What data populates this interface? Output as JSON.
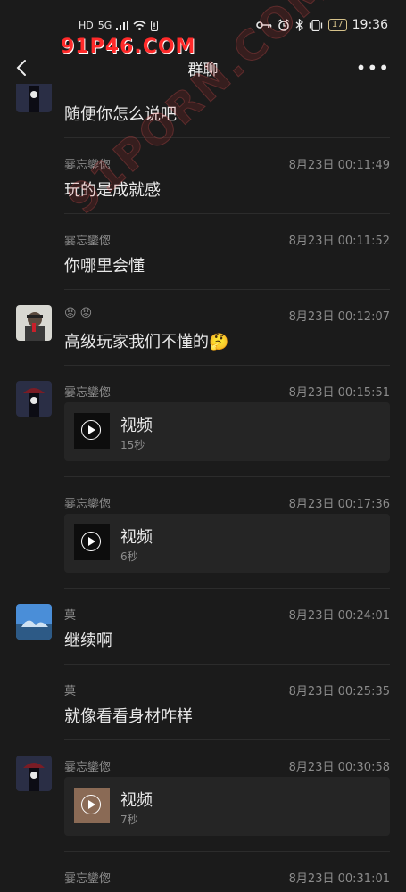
{
  "status_bar": {
    "left_icons": [
      "HD",
      "5G",
      "signal-icon",
      "wifi-icon",
      "alert-icon"
    ],
    "right_icons": [
      "key-icon",
      "alarm-icon",
      "bluetooth-icon",
      "vibrate-icon"
    ],
    "battery": "17",
    "time": "19:36"
  },
  "watermark": {
    "top": "91P46.COM",
    "diagonal": "91PORN.COM"
  },
  "nav": {
    "title": "群聊",
    "more": "•••"
  },
  "messages": [
    {
      "sender": "",
      "time": "",
      "text": "随便你怎么说吧"
    },
    {
      "sender": "霎忘鑾偬",
      "time": "8月23日 00:11:49",
      "text": "玩的是成就感"
    },
    {
      "sender": "霎忘鑾偬",
      "time": "8月23日 00:11:52",
      "text": "你哪里会懂"
    },
    {
      "sender": "😡 😡",
      "time": "8月23日 00:12:07",
      "text": "高级玩家我们不懂的🤔"
    },
    {
      "sender": "霎忘鑾偬",
      "time": "8月23日 00:15:51",
      "video_label": "视频",
      "duration": "15秒"
    },
    {
      "sender": "霎忘鑾偬",
      "time": "8月23日 00:17:36",
      "video_label": "视频",
      "duration": "6秒"
    },
    {
      "sender": "菓",
      "time": "8月23日 00:24:01",
      "text": "继续啊"
    },
    {
      "sender": "菓",
      "time": "8月23日 00:25:35",
      "text": "就像看看身材咋样"
    },
    {
      "sender": "霎忘鑾偬",
      "time": "8月23日 00:30:58",
      "video_label": "视频",
      "duration": "7秒"
    },
    {
      "sender": "霎忘鑾偬",
      "time": "8月23日 00:31:01"
    }
  ],
  "colors": {
    "background": "#1b1b1b",
    "card": "#252525",
    "meta_text": "#8c8c8c",
    "main_text": "#e8e8e8",
    "watermark": "#ff2a2a"
  }
}
